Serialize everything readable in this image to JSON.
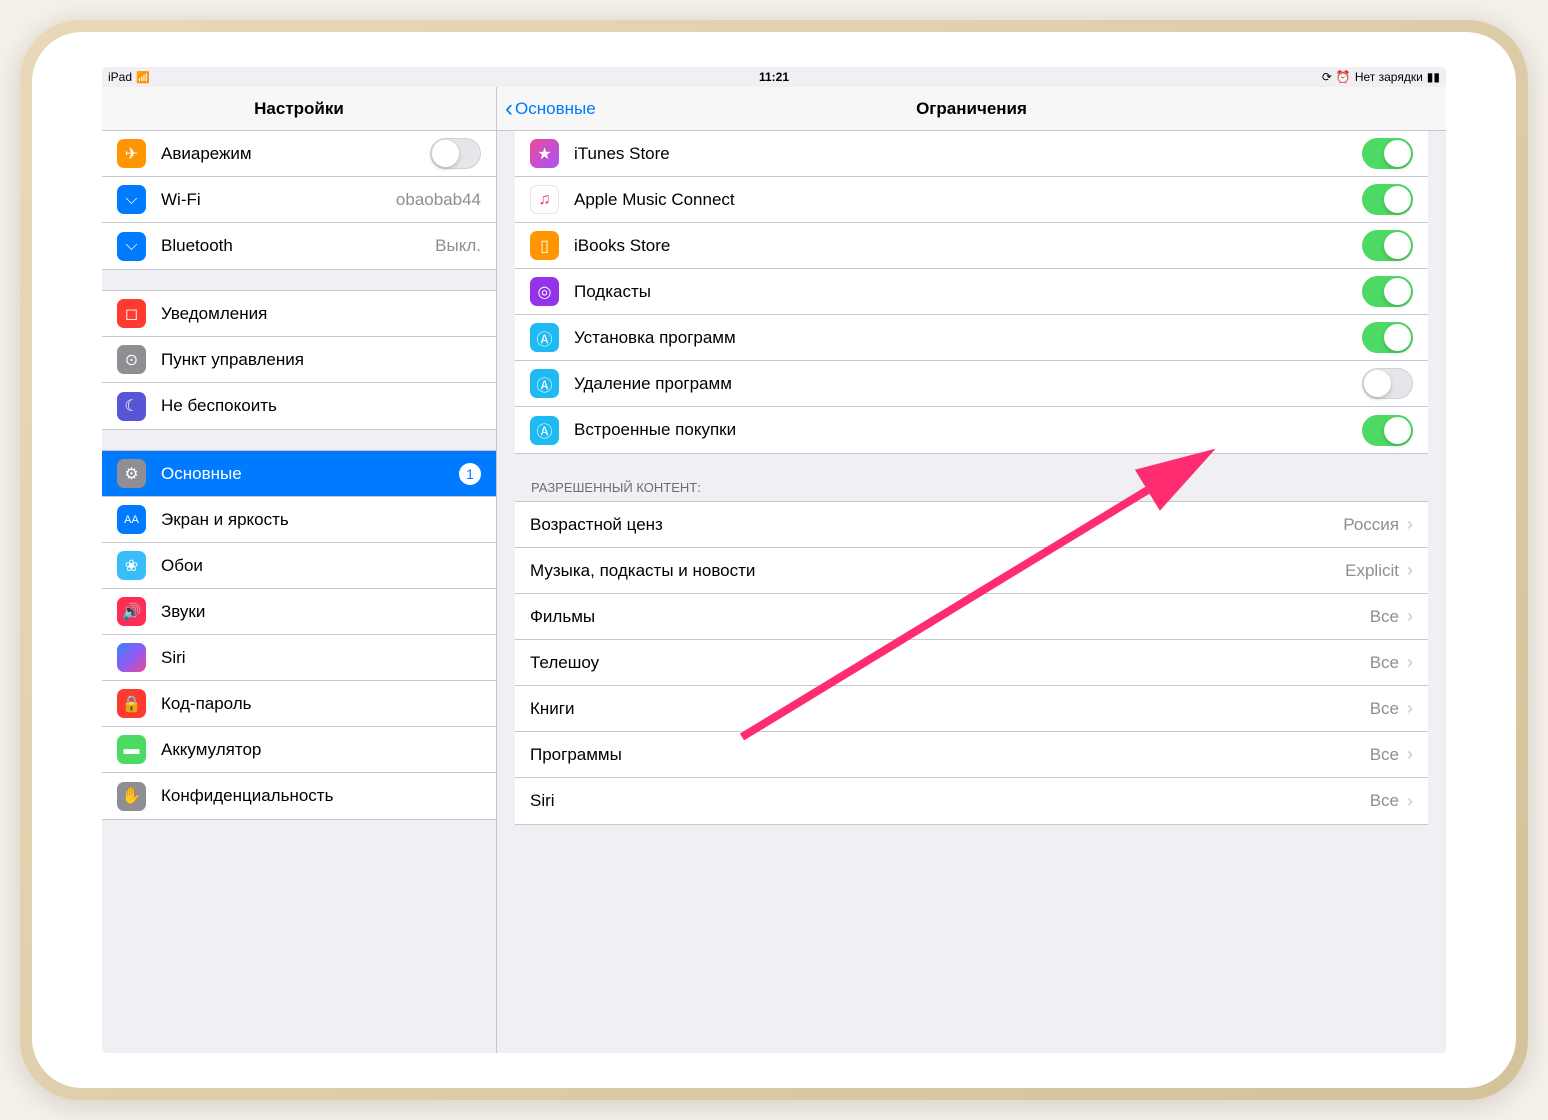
{
  "statusBar": {
    "device": "iPad",
    "time": "11:21",
    "battery": "Нет зарядки"
  },
  "sidebar": {
    "title": "Настройки",
    "groups": [
      [
        {
          "id": "airplane",
          "label": "Авиарежим",
          "icon": "ic-airplane",
          "glyph": "✈",
          "toggle": false
        },
        {
          "id": "wifi",
          "label": "Wi-Fi",
          "icon": "ic-wifi",
          "glyph": "⌵",
          "detail": "obaobab44"
        },
        {
          "id": "bluetooth",
          "label": "Bluetooth",
          "icon": "ic-bluetooth",
          "glyph": "⌵",
          "detail": "Выкл."
        }
      ],
      [
        {
          "id": "notifications",
          "label": "Уведомления",
          "icon": "ic-notifications",
          "glyph": "◻"
        },
        {
          "id": "control",
          "label": "Пункт управления",
          "icon": "ic-control",
          "glyph": "⊙"
        },
        {
          "id": "dnd",
          "label": "Не беспокоить",
          "icon": "ic-dnd",
          "glyph": "☾"
        }
      ],
      [
        {
          "id": "general",
          "label": "Основные",
          "icon": "ic-general",
          "glyph": "⚙",
          "selected": true,
          "badge": "1"
        },
        {
          "id": "display",
          "label": "Экран и яркость",
          "icon": "ic-display",
          "glyph": "AA"
        },
        {
          "id": "wallpaper",
          "label": "Обои",
          "icon": "ic-wallpaper",
          "glyph": "❀"
        },
        {
          "id": "sounds",
          "label": "Звуки",
          "icon": "ic-sounds",
          "glyph": "🔊"
        },
        {
          "id": "siri",
          "label": "Siri",
          "icon": "ic-siri",
          "glyph": ""
        },
        {
          "id": "passcode",
          "label": "Код-пароль",
          "icon": "ic-passcode",
          "glyph": "🔒"
        },
        {
          "id": "battery",
          "label": "Аккумулятор",
          "icon": "ic-battery",
          "glyph": "▬"
        },
        {
          "id": "privacy",
          "label": "Конфиденциальность",
          "icon": "ic-privacy",
          "glyph": "✋"
        }
      ]
    ]
  },
  "main": {
    "back": "Основные",
    "title": "Ограничения",
    "toggles": [
      {
        "id": "itunes",
        "label": "iTunes Store",
        "icon": "ic-itunes",
        "glyph": "★",
        "on": true
      },
      {
        "id": "applemusic",
        "label": "Apple Music Connect",
        "icon": "ic-music",
        "glyph": "♫",
        "on": true
      },
      {
        "id": "ibooks",
        "label": "iBooks Store",
        "icon": "ic-ibooks",
        "glyph": "▯",
        "on": true
      },
      {
        "id": "podcasts",
        "label": "Подкасты",
        "icon": "ic-podcasts",
        "glyph": "◎",
        "on": true
      },
      {
        "id": "install",
        "label": "Установка программ",
        "icon": "ic-appstore",
        "glyph": "Ⓐ",
        "on": true
      },
      {
        "id": "delete",
        "label": "Удаление программ",
        "icon": "ic-appstore",
        "glyph": "Ⓐ",
        "on": false
      },
      {
        "id": "inapp",
        "label": "Встроенные покупки",
        "icon": "ic-appstore",
        "glyph": "Ⓐ",
        "on": true
      }
    ],
    "contentHeader": "РАЗРЕШЕННЫЙ КОНТЕНТ:",
    "contentRows": [
      {
        "id": "rating",
        "label": "Возрастной ценз",
        "detail": "Россия"
      },
      {
        "id": "music",
        "label": "Музыка, подкасты и новости",
        "detail": "Explicit"
      },
      {
        "id": "movies",
        "label": "Фильмы",
        "detail": "Все"
      },
      {
        "id": "tv",
        "label": "Телешоу",
        "detail": "Все"
      },
      {
        "id": "books",
        "label": "Книги",
        "detail": "Все"
      },
      {
        "id": "apps",
        "label": "Программы",
        "detail": "Все"
      },
      {
        "id": "siri",
        "label": "Siri",
        "detail": "Все"
      }
    ]
  }
}
